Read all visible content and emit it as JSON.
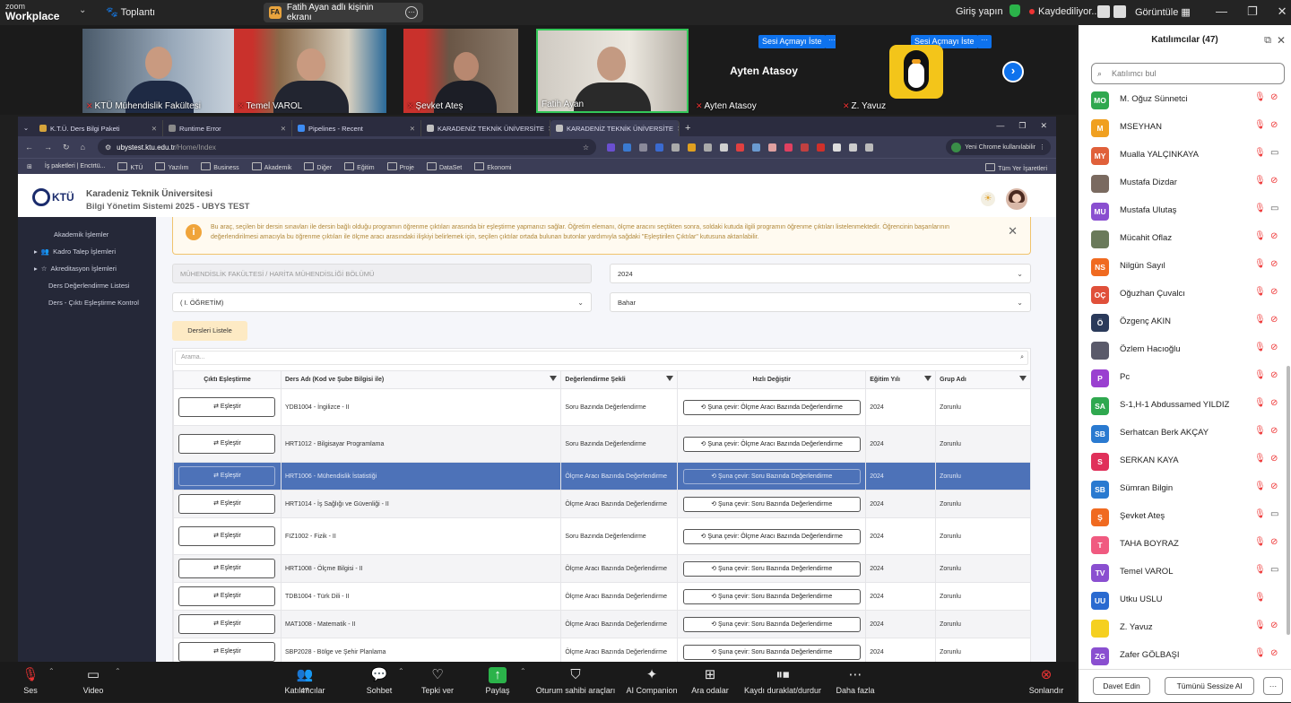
{
  "zoom": {
    "logo_line1": "zoom",
    "logo_line2": "Workplace",
    "meeting_label": "Toplantı",
    "share_initials": "FA",
    "share_badge": "Fatih Ayan adlı kişinin ekranı",
    "login": "Giriş yapın",
    "recording": "Kaydediliyor...",
    "view_label": "Görüntüle"
  },
  "gallery": [
    {
      "name": "KTÜ Mühendislik Fakültesi"
    },
    {
      "name": "Temel VAROL"
    },
    {
      "name": "Şevket Ateş"
    },
    {
      "name": "Fatih Ayan"
    },
    {
      "name": "Ayten Atasoy",
      "center": "Ayten Atasoy",
      "ask": "Sesi Açmayı İste"
    },
    {
      "name": "Z. Yavuz",
      "ask": "Sesi Açmayı İste"
    }
  ],
  "browser": {
    "tabs": [
      {
        "label": "K.T.Ü. Ders Bilgi Paketi",
        "color": "#d6a43b"
      },
      {
        "label": "Runtime Error",
        "color": "#8a8a8a"
      },
      {
        "label": "Pipelines - Recent",
        "color": "#3d8bf2"
      },
      {
        "label": "KARADENİZ TEKNİK ÜNİVERSİTE",
        "color": "#c0c0c0"
      },
      {
        "label": "KARADENİZ TEKNİK ÜNİVERSİTE",
        "color": "#c0c0c0",
        "active": true
      }
    ],
    "url_host": "ubystest.ktu.edu.tr",
    "url_path": "/Home/Index",
    "profile": "Yeni Chrome kullanılabilir",
    "bookmarks": [
      "İş paketleri | Enctrtü...",
      "KTÜ",
      "Yazılım",
      "Business",
      "Akademik",
      "Diğer",
      "Eğitim",
      "Proje",
      "DataSet",
      "Ekonomi"
    ],
    "all_bookmarks": "Tüm Yer İşaretleri"
  },
  "app": {
    "logo": "KTÜ",
    "title_line1": "Karadeniz Teknik Üniversitesi",
    "title_line2": "Bilgi Yönetim Sistemi 2025 - UBYS TEST",
    "sidebar": [
      "Akademik İşlemler",
      "Kadro Talep İşlemleri",
      "Akreditasyon İşlemleri",
      "Ders Değerlendirme Listesi",
      "Ders - Çıktı Eşleştirme Kontrol"
    ],
    "alert_text": "Bu araç, seçilen bir dersin sınavları ile dersin bağlı olduğu programın öğrenme çıktıları arasında bir eşleştirme yapmanızı sağlar. Öğretim elemanı, ölçme aracını seçtikten sonra, soldaki kutuda ilgili programın öğrenme çıktıları listelenmektedir. Öğrencinin başarılarının değerlendirilmesi amacıyla bu öğrenme çıktıları ile ölçme aracı arasındaki ilişkiyi belirlemek için, seçilen çıktılar ortada bulunan butonlar yardımıyla sağdaki \"Eşleştirilen Çıktılar\" kutusuna aktarılabilir.",
    "faculty": "MÜHENDİSLİK FAKÜLTESİ / HARİTA MÜHENDİSLİĞİ BÖLÜMÜ",
    "year": "2024",
    "education": "( I. ÖĞRETİM)",
    "term": "Bahar",
    "list_button": "Dersleri Listele",
    "search_placeholder": "Arama...",
    "columns": [
      "Çıktı Eşleştirme",
      "Ders Adı (Kod ve Şube Bilgisi ile)",
      "Değerlendirme Şekli",
      "Hızlı Değiştir",
      "Eğitim Yılı",
      "Grup Adı"
    ],
    "rows": [
      {
        "btn": "Eşleştir",
        "course": "YDB1004 - İngilizce - II",
        "method": "Soru Bazında Değerlendirme",
        "quick": "Şuna çevir: Ölçme Aracı Bazında Değerlendirme",
        "year": "2024",
        "group": "Zorunlu"
      },
      {
        "btn": "Eşleştir",
        "course": "HRT1012 - Bilgisayar Programlama",
        "method": "Soru Bazında Değerlendirme",
        "quick": "Şuna çevir: Ölçme Aracı Bazında Değerlendirme",
        "year": "2024",
        "group": "Zorunlu"
      },
      {
        "btn": "Eşleştir",
        "course": "HRT1006 - Mühendislik İstatistiği",
        "method": "Ölçme Aracı Bazında Değerlendirme",
        "quick": "Şuna çevir: Soru Bazında Değerlendirme",
        "year": "2024",
        "group": "Zorunlu",
        "selected": true
      },
      {
        "btn": "Eşleştir",
        "course": "HRT1014 - İş Sağlığı ve Güvenliği - II",
        "method": "Ölçme Aracı Bazında Değerlendirme",
        "quick": "Şuna çevir: Soru Bazında Değerlendirme",
        "year": "2024",
        "group": "Zorunlu"
      },
      {
        "btn": "Eşleştir",
        "course": "FIZ1002 - Fizik - II",
        "method": "Soru Bazında Değerlendirme",
        "quick": "Şuna çevir: Ölçme Aracı Bazında Değerlendirme",
        "year": "2024",
        "group": "Zorunlu"
      },
      {
        "btn": "Eşleştir",
        "course": "HRT1008 - Ölçme Bilgisi - II",
        "method": "Ölçme Aracı Bazında Değerlendirme",
        "quick": "Şuna çevir: Soru Bazında Değerlendirme",
        "year": "2024",
        "group": "Zorunlu"
      },
      {
        "btn": "Eşleştir",
        "course": "TDB1004 - Türk Dili - II",
        "method": "Ölçme Aracı Bazında Değerlendirme",
        "quick": "Şuna çevir: Soru Bazında Değerlendirme",
        "year": "2024",
        "group": "Zorunlu"
      },
      {
        "btn": "Eşleştir",
        "course": "MAT1008 - Matematik - II",
        "method": "Ölçme Aracı Bazında Değerlendirme",
        "quick": "Şuna çevir: Soru Bazında Değerlendirme",
        "year": "2024",
        "group": "Zorunlu"
      },
      {
        "btn": "Eşleştir",
        "course": "SBP2028 - Bölge ve Şehir Planlama",
        "method": "Ölçme Aracı Bazında Değerlendirme",
        "quick": "Şuna çevir: Soru Bazında Değerlendirme",
        "year": "2024",
        "group": "Zorunlu"
      }
    ]
  },
  "participants": {
    "title": "Katılımcılar (47)",
    "search_placeholder": "Katılımcı bul",
    "list": [
      {
        "ini": "MO",
        "name": "M. Oğuz Sünnetci",
        "color": "#2fa84f"
      },
      {
        "ini": "M",
        "name": "MSEYHAN",
        "color": "#f0a020"
      },
      {
        "ini": "MY",
        "name": "Mualla YALÇINKAYA",
        "color": "#e0603a"
      },
      {
        "ini": "",
        "name": "Mustafa Dizdar",
        "color": "#7a6a60"
      },
      {
        "ini": "MU",
        "name": "Mustafa Ulutaş",
        "color": "#8a4fd0"
      },
      {
        "ini": "",
        "name": "Mücahit Oflaz",
        "color": "#6a7a5a"
      },
      {
        "ini": "NS",
        "name": "Nilgün Sayıl",
        "color": "#f06a20"
      },
      {
        "ini": "OÇ",
        "name": "Oğuzhan Çuvalcı",
        "color": "#e0503a"
      },
      {
        "ini": "Ö",
        "name": "Özgenç AKIN",
        "color": "#2a3a5a"
      },
      {
        "ini": "",
        "name": "Özlem Hacıoğlu",
        "color": "#5a5a6a"
      },
      {
        "ini": "P",
        "name": "Pc",
        "color": "#9a40d0"
      },
      {
        "ini": "SA",
        "name": "S-1,H-1 Abdussamed YILDIZ",
        "color": "#2fa84f"
      },
      {
        "ini": "SB",
        "name": "Serhatcan Berk AKÇAY",
        "color": "#2a7ad0"
      },
      {
        "ini": "S",
        "name": "SERKAN KAYA",
        "color": "#e0305a"
      },
      {
        "ini": "SB",
        "name": "Sümran Bilgin",
        "color": "#2a7ad0"
      },
      {
        "ini": "Ş",
        "name": "Şevket Ateş",
        "color": "#f06a20"
      },
      {
        "ini": "T",
        "name": "TAHA BOYRAZ",
        "color": "#f05a80"
      },
      {
        "ini": "TV",
        "name": "Temel VAROL",
        "color": "#8a4fd0"
      },
      {
        "ini": "UU",
        "name": "Utku USLU",
        "color": "#2a6ad0"
      },
      {
        "ini": "",
        "name": "Z. Yavuz",
        "color": "#f5d020"
      },
      {
        "ini": "ZG",
        "name": "Zafer GÖLBAŞI",
        "color": "#8a4fd0"
      }
    ],
    "invite": "Davet Edin",
    "mute_all": "Tümünü Sessize Al",
    "more": "···"
  },
  "toolbar": {
    "audio": "Ses",
    "video": "Video",
    "participants": "Katılımcılar",
    "participants_count": "47",
    "chat": "Sohbet",
    "react": "Tepki ver",
    "share": "Paylaş",
    "host_tools": "Oturum sahibi araçları",
    "companion": "AI Companion",
    "breakout": "Ara odalar",
    "pause_rec": "Kaydı duraklat/durdur",
    "more": "Daha fazla",
    "end": "Sonlandır"
  }
}
